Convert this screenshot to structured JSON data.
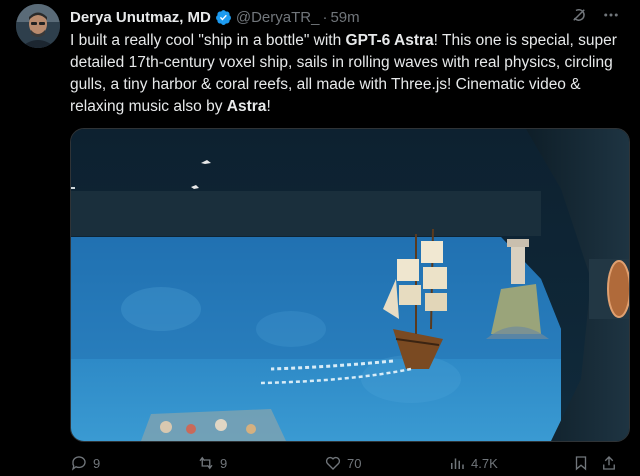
{
  "author": {
    "display_name": "Derya Unutmaz, MD",
    "handle": "@DeryaTR_",
    "separator": "·",
    "time": "59m",
    "verified": true
  },
  "tweet": {
    "text_1": "I built a really cool \"ship in a bottle\" with ",
    "bold_1": "GPT-6 Astra",
    "text_2": "! This one is special, super detailed 17th-century voxel ship, sails in rolling waves with real physics, circling gulls, a tiny harbor & coral reefs, all made with Three.js! Cinematic video & relaxing music also by ",
    "bold_2": "Astra",
    "text_3": "!"
  },
  "actions": {
    "replies": "9",
    "reposts": "9",
    "likes": "70",
    "views": "4.7K"
  },
  "icons": {
    "header": [
      "grok-icon",
      "more-icon"
    ],
    "actions": [
      "reply-icon",
      "repost-icon",
      "like-icon",
      "views-icon",
      "bookmark-icon",
      "share-icon"
    ]
  },
  "colors": {
    "background": "#000000",
    "text": "#e7e9ea",
    "muted": "#71767b",
    "verified": "#1d9bf0"
  }
}
